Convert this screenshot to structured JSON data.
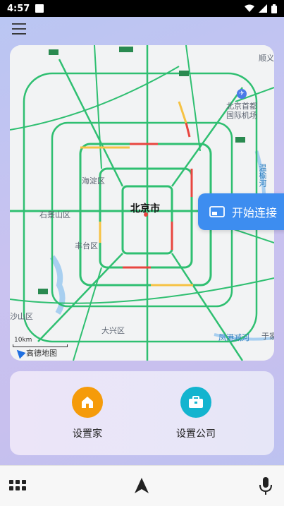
{
  "status_bar": {
    "time": "4:57"
  },
  "map": {
    "labels": {
      "shunyi": "顺义",
      "airport": "北京首都\n国际机场",
      "haidian": "海淀区",
      "shijingshan": "石景山区",
      "beijing": "北京市",
      "fengtai": "丰台区",
      "mentougou": "沙山区",
      "daxing": "大兴区",
      "fenggang": "凤港减河",
      "yujia": "于家",
      "wenyu": "温榆河"
    },
    "scale": "10km",
    "logo": "高德地图"
  },
  "connect": {
    "label": "开始连接"
  },
  "places": {
    "home_label": "设置家",
    "company_label": "设置公司"
  },
  "colors": {
    "accent": "#3d8df0",
    "home": "#f59b0a",
    "company": "#13b4cf",
    "traffic_green": "#2fbf71",
    "traffic_yellow": "#f6c243",
    "traffic_red": "#e8463f"
  }
}
